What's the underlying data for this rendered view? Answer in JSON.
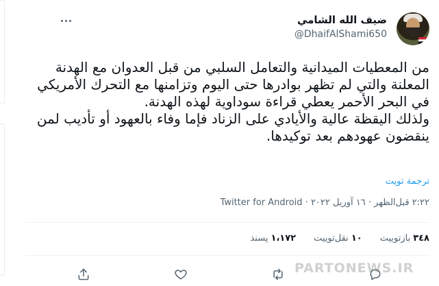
{
  "tweet": {
    "display_name": "ضيف الله الشامي",
    "handle": "@DhaifAlShami650",
    "body_lines": [
      "من المعطيات الميدانية والتعامل السلبي من قبل العدوان مع الهدنة المعلنة والتي لم تظهر بوادرها حتى اليوم وتزامنها مع التحرك الأمريكي في البحر الأحمر يعطي قراءة سوداوية لهذه الهدنة.",
      "ولذلك اليقظة عالية والأيادي على الزناد فإما وفاء بالعهود أو تأديب لمن ينقضون عهودهم بعد توكيدها."
    ],
    "translate_label": "ترجمة تويت",
    "timestamp": "٢:٢٢ قبل‌الظهر · ١٦ آوريل ٢٠٢٢",
    "separator": " · ",
    "source": "Twitter for Android"
  },
  "stats": {
    "retweets_count": "٣٤٨",
    "retweets_label": "بازتوییت",
    "quotes_count": "١٠",
    "quotes_label": "نقل‌توییت",
    "likes_count": "١،١٧٢",
    "likes_label": "پسند"
  },
  "icons": {
    "more": "more-horizontal-icon",
    "reply": "reply-icon",
    "retweet": "retweet-icon",
    "like": "heart-icon",
    "share": "share-icon"
  },
  "watermark": "PARTONEWS.IR",
  "colors": {
    "link": "#1d9bf0",
    "muted": "#536471",
    "text": "#0f1419",
    "divider": "#eff3f4"
  }
}
